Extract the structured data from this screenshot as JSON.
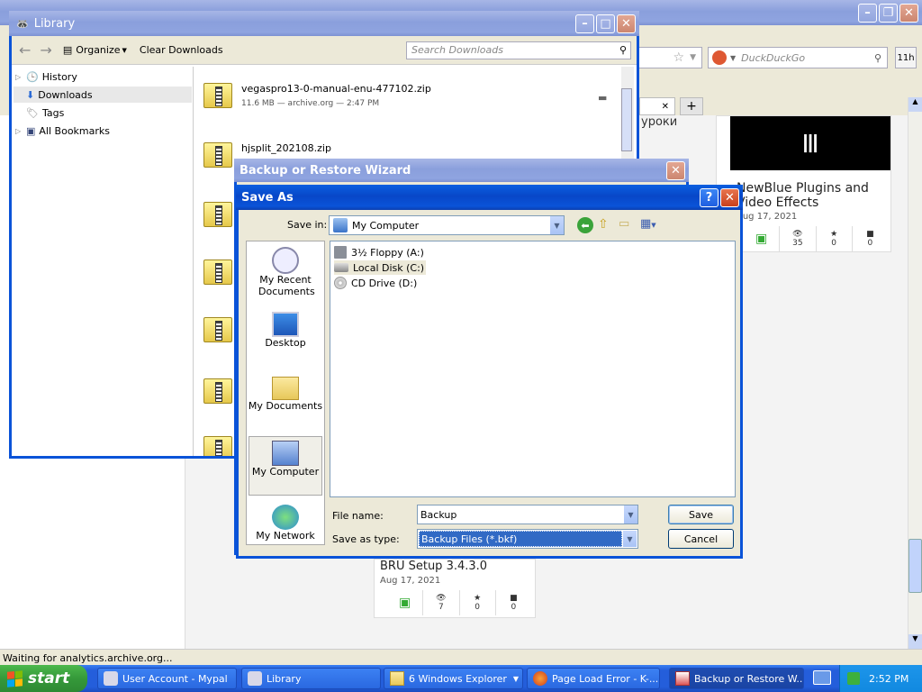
{
  "browser": {
    "title": "",
    "search_placeholder": "DuckDuckGo",
    "ext_badge": "11h",
    "tab_close": "✕",
    "new_tab": "+",
    "status_text": "Waiting for analytics.archive.org...",
    "partial_text": "уроки"
  },
  "page_cards": {
    "card1": {
      "title_line1": "NewBlue Plugins and",
      "title_line2": "Video Effects",
      "date": "Aug 17, 2021",
      "views": "35",
      "favs": "0",
      "reviews": "0"
    },
    "card2": {
      "title": "BRU Setup 3.4.3.0",
      "date": "Aug 17, 2021",
      "views": "7",
      "favs": "0",
      "reviews": "0"
    }
  },
  "library": {
    "title": "Library",
    "organize": "Organize",
    "clear_downloads": "Clear Downloads",
    "search_placeholder": "Search Downloads",
    "sidebar": [
      {
        "label": "History"
      },
      {
        "label": "Downloads"
      },
      {
        "label": "Tags"
      },
      {
        "label": "All Bookmarks"
      }
    ],
    "downloads": [
      {
        "name": "vegaspro13-0-manual-enu-477102.zip",
        "meta": "11.6 MB — archive.org — 2:47 PM"
      },
      {
        "name": "hjsplit_202108.zip",
        "meta": ""
      }
    ]
  },
  "wizard": {
    "title": "Backup or Restore Wizard"
  },
  "saveas": {
    "title": "Save As",
    "help": "?",
    "save_in_label": "Save in:",
    "save_in_value": "My Computer",
    "places": [
      {
        "label": "My Recent Documents"
      },
      {
        "label": "Desktop"
      },
      {
        "label": "My Documents"
      },
      {
        "label": "My Computer"
      },
      {
        "label": "My Network"
      }
    ],
    "files": [
      {
        "label": "3½ Floppy (A:)"
      },
      {
        "label": "Local Disk (C:)"
      },
      {
        "label": "CD Drive (D:)"
      }
    ],
    "filename_label": "File name:",
    "filename_value": "Backup",
    "type_label": "Save as type:",
    "type_value": "Backup Files (*.bkf)",
    "save_btn": "Save",
    "cancel_btn": "Cancel"
  },
  "taskbar": {
    "start": "start",
    "tasks": [
      {
        "label": "User Account - Mypal"
      },
      {
        "label": "Library"
      },
      {
        "label": "6 Windows Explorer"
      },
      {
        "label": "Page Load Error - K-..."
      },
      {
        "label": "Backup or Restore W..."
      }
    ],
    "clock": "2:52 PM"
  },
  "colors": {
    "xp_blue": "#0a53d8",
    "taskbar": "#245edb",
    "tray": "#0f93e8",
    "start_green": "#3c9a3c"
  }
}
